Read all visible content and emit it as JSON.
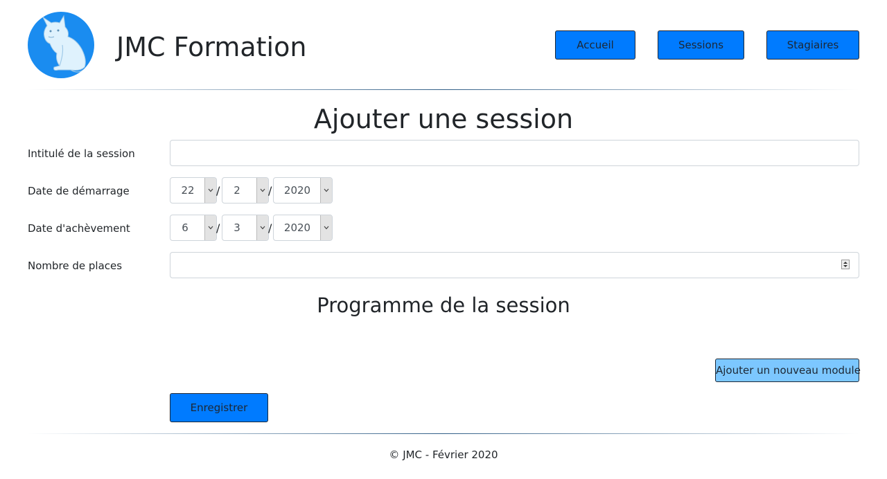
{
  "header": {
    "brand": "JMC Formation",
    "nav": [
      {
        "label": "Accueil"
      },
      {
        "label": "Sessions"
      },
      {
        "label": "Stagiaires"
      }
    ]
  },
  "form": {
    "title": "Ajouter une session",
    "fields": {
      "session_title": {
        "label": "Intitulé de la session",
        "value": ""
      },
      "start_date": {
        "label": "Date de démarrage",
        "day": "22",
        "month": "2",
        "year": "2020"
      },
      "end_date": {
        "label": "Date d'achèvement",
        "day": "6",
        "month": "3",
        "year": "2020"
      },
      "places": {
        "label": "Nombre de places",
        "value": ""
      }
    },
    "date_separator": "/",
    "program_title": "Programme de la session",
    "add_module_label": "Ajouter un nouveau module",
    "save_label": "Enregistrer"
  },
  "footer": {
    "text": "© JMC - Février 2020"
  },
  "colors": {
    "primary": "#007bff",
    "secondary_button": "#7cc7ff",
    "logo_bg": "#1a8cf0"
  },
  "icons": {
    "logo": "cat-icon",
    "select_arrow": "chevron-down-icon",
    "spinner": "number-spinner-icon"
  }
}
